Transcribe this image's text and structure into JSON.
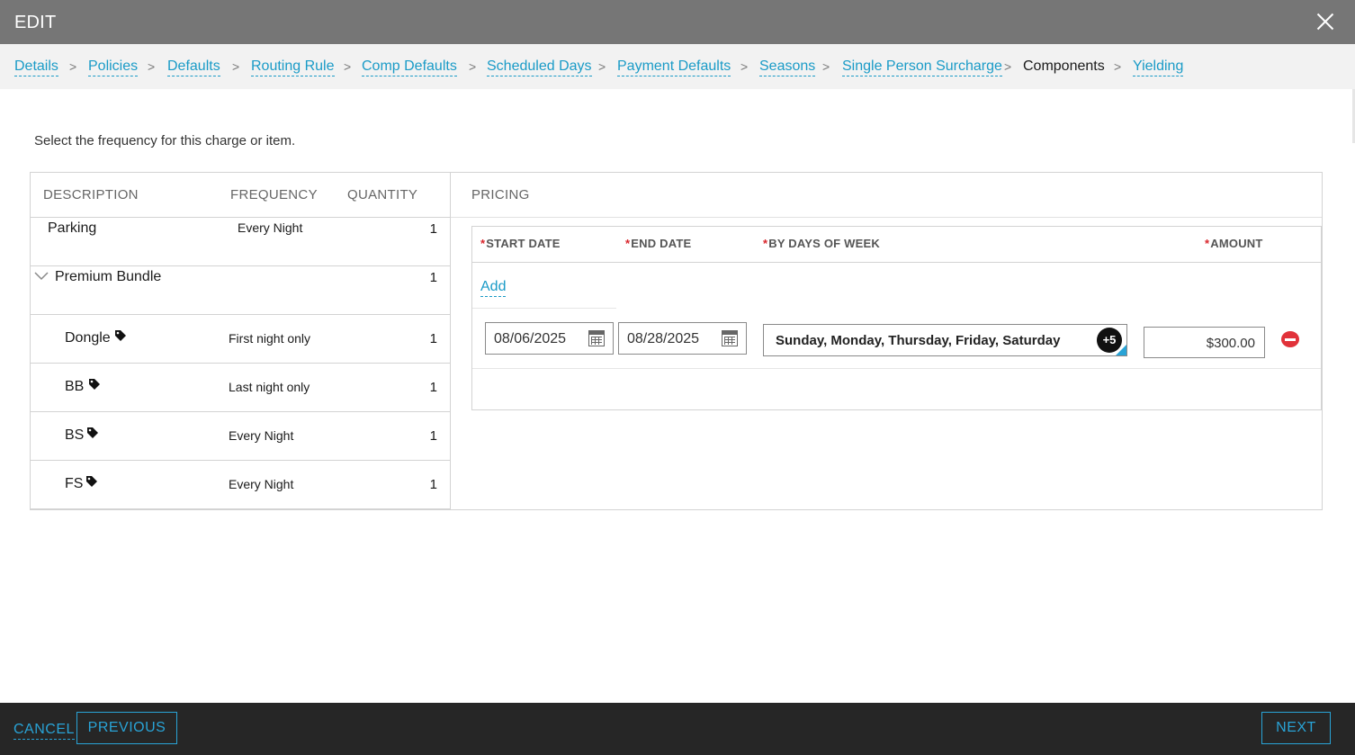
{
  "dialog": {
    "title": "EDIT"
  },
  "breadcrumbs": [
    {
      "label": "Details"
    },
    {
      "label": "Policies"
    },
    {
      "label": "Defaults"
    },
    {
      "label": "Routing Rule"
    },
    {
      "label": "Comp Defaults"
    },
    {
      "label": "Scheduled Days"
    },
    {
      "label": "Payment Defaults"
    },
    {
      "label": "Seasons"
    },
    {
      "label": "Single Person Surcharge"
    },
    {
      "label": "Components",
      "current": true
    },
    {
      "label": "Yielding"
    }
  ],
  "breadcrumb_separator": ">",
  "instructions": "Select the frequency for this charge or item.",
  "components": {
    "headers": {
      "description": "DESCRIPTION",
      "frequency": "FREQUENCY",
      "quantity": "QUANTITY"
    },
    "rows": [
      {
        "description": "Parking",
        "frequency": "Every Night",
        "quantity": "1",
        "icon": null
      },
      {
        "description": "Premium Bundle",
        "frequency": "",
        "quantity": "1",
        "icon": "chevron-down-icon",
        "expanded": true
      },
      {
        "description": "Dongle",
        "frequency": "First night only",
        "quantity": "1",
        "icon": "tag-icon"
      },
      {
        "description": "BB",
        "frequency": "Last night only",
        "quantity": "1",
        "icon": "tag-icon"
      },
      {
        "description": "BS",
        "frequency": "Every Night",
        "quantity": "1",
        "icon": "tag-icon"
      },
      {
        "description": "FS",
        "frequency": "Every Night",
        "quantity": "1",
        "icon": "tag-icon"
      }
    ]
  },
  "pricing": {
    "header": "PRICING",
    "required_marker": "*",
    "columns": {
      "start_date": "START DATE",
      "end_date": "END DATE",
      "days_of_week": "BY DAYS OF WEEK",
      "amount": "AMOUNT"
    },
    "add_label": "Add",
    "rows": [
      {
        "start_date": "08/06/2025",
        "end_date": "08/28/2025",
        "days_of_week": "Sunday, Monday, Thursday, Friday, Saturday",
        "days_more_badge": "+5",
        "amount": "$300.00"
      }
    ]
  },
  "footer": {
    "cancel_label": "CANCEL",
    "previous_label": "PREVIOUS",
    "next_label": "NEXT"
  },
  "colors": {
    "header_bg": "#767676",
    "link": "#1a9bc7",
    "required": "#d9252b",
    "remove": "#e1323a",
    "footer_bg": "#262626"
  }
}
